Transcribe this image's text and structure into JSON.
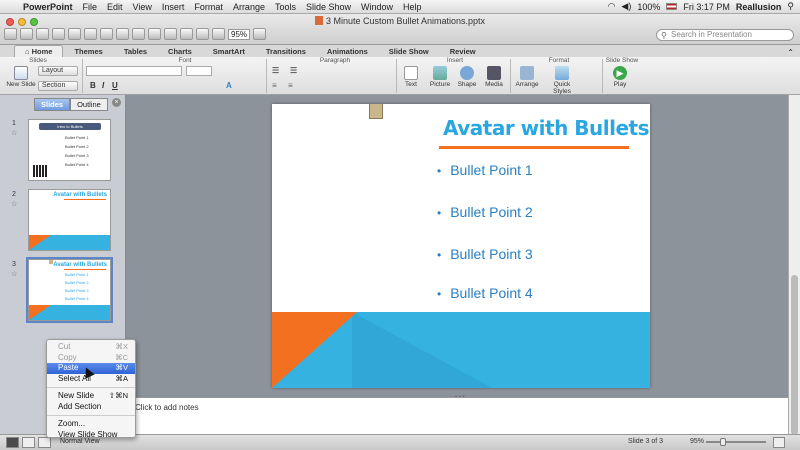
{
  "menubar": {
    "app": "PowerPoint",
    "items": [
      "File",
      "Edit",
      "View",
      "Insert",
      "Format",
      "Arrange",
      "Tools",
      "Slide Show",
      "Window",
      "Help"
    ],
    "battery": "100%",
    "clock": "Fri 3:17 PM",
    "user": "Reallusion"
  },
  "window": {
    "title": "3 Minute Custom Bullet Animations.pptx",
    "zoom": "95%",
    "search_placeholder": "Search in Presentation"
  },
  "ribbon": {
    "tabs": [
      "Home",
      "Themes",
      "Tables",
      "Charts",
      "SmartArt",
      "Transitions",
      "Animations",
      "Slide Show",
      "Review"
    ],
    "active_tab": "Home",
    "groups": [
      "Slides",
      "Font",
      "Paragraph",
      "Insert",
      "Format",
      "Slide Show"
    ],
    "new_slide": "New Slide",
    "layout": "Layout",
    "section": "Section",
    "insert_buttons": [
      "Text",
      "Picture",
      "Shape",
      "Media"
    ],
    "format_buttons": [
      "Arrange",
      "Quick Styles"
    ],
    "play": "Play"
  },
  "pane": {
    "tabs": [
      "Slides",
      "Outline"
    ],
    "active_tab": "Slides",
    "thumbnails": [
      {
        "num": "1",
        "title": "Intro to Bullets",
        "bullets": [
          "Bullet Point 1",
          "Bullet Point 2",
          "Bullet Point 3",
          "Bullet Point 4"
        ]
      },
      {
        "num": "2",
        "title": "Avatar with Bullets"
      },
      {
        "num": "3",
        "title": "Avatar with Bullets",
        "bullets": [
          "Bullet Point 1",
          "Bullet Point 2",
          "Bullet Point 3",
          "Bullet Point 4"
        ]
      }
    ]
  },
  "slide": {
    "title": "Avatar with Bullets",
    "bullets": [
      "Bullet Point 1",
      "Bullet Point 2",
      "Bullet Point 3",
      "Bullet Point 4"
    ],
    "colors": {
      "title": "#2aa7e0",
      "accent": "#f37021",
      "band": "#36b2e0",
      "bullet": "#2a7fc1"
    }
  },
  "notes": {
    "placeholder": "Click to add notes"
  },
  "status": {
    "view": "Normal View",
    "slide": "Slide 3 of 3",
    "zoom": "95%"
  },
  "context_menu": {
    "items": [
      {
        "label": "Cut",
        "shortcut": "⌘X",
        "disabled": true
      },
      {
        "label": "Copy",
        "shortcut": "⌘C",
        "disabled": true
      },
      {
        "label": "Paste",
        "shortcut": "⌘V",
        "highlighted": true
      },
      {
        "label": "Select All",
        "shortcut": "⌘A"
      },
      {
        "label": "New Slide",
        "shortcut": "⇧⌘N"
      },
      {
        "label": "Add Section",
        "shortcut": ""
      },
      {
        "label": "Zoom...",
        "shortcut": ""
      },
      {
        "label": "View Slide Show",
        "shortcut": ""
      }
    ]
  }
}
